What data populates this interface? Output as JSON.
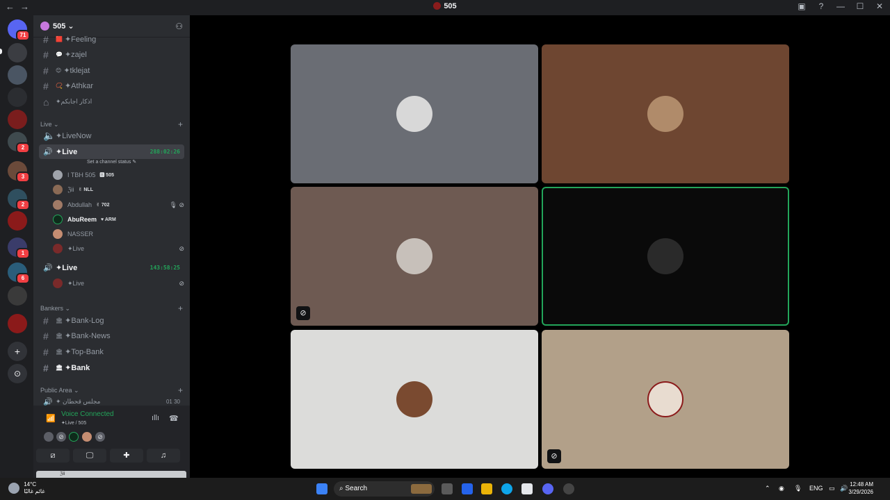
{
  "window": {
    "title": "505",
    "back": "←",
    "forward": "→",
    "controls": [
      "▣",
      "?",
      "—",
      "☐",
      "✕"
    ]
  },
  "server": {
    "name": "505 ⌄",
    "invite_icon": "add-user-icon"
  },
  "guild_badges": [
    "71",
    "2",
    "3",
    "2",
    "1",
    "6"
  ],
  "channels": {
    "top": [
      {
        "name": "✦Feeling",
        "emoji": "🟥"
      },
      {
        "name": "✦zajel",
        "emoji": "💬"
      },
      {
        "name": "✦tklejat",
        "emoji": "😊"
      },
      {
        "name": "✦Athkar",
        "emoji": "📿"
      },
      {
        "name": "✦اذكار اجابكم",
        "emoji": ""
      }
    ],
    "live_category": "Live ⌄",
    "live": [
      {
        "name": "✦LiveNow"
      },
      {
        "name": "✦Live",
        "timer": "288:02:26",
        "status": "Set a channel status ✎"
      },
      {
        "name": "✦Live",
        "timer": "143:58:25"
      }
    ],
    "voice_users": [
      {
        "name": "I TBH 505",
        "tag": "🅱 505",
        "color": "#9fa3aa"
      },
      {
        "name": "ℨii",
        "tag": "✌ NLL",
        "color": "#8a6a55"
      },
      {
        "name": "Abdullah",
        "tag": "✌ 702",
        "color": "#a07a66",
        "right": "🎙 ⊘"
      },
      {
        "name": "AbuReem",
        "tag": "♥ ARM",
        "color": "#0e2b1b"
      },
      {
        "name": "NASSER",
        "tag": "",
        "color": "#c58d72"
      },
      {
        "name": "✦Live",
        "tag": "",
        "color": "#7a2a2a",
        "right": "⊘"
      }
    ],
    "second_live_user": {
      "name": "✦Live",
      "right": "⊘"
    },
    "bankers_category": "Bankers ⌄",
    "bankers": [
      {
        "name": "✦Bank-Log"
      },
      {
        "name": "✦Bank-News"
      },
      {
        "name": "✦Top-Bank"
      },
      {
        "name": "✦Bank"
      }
    ],
    "public_category": "Public Area ⌄",
    "public": [
      {
        "name": "✦ مجلس قحطان",
        "count_left": "01",
        "count_right": "30"
      }
    ]
  },
  "voice_panel": {
    "title": "Voice Connected",
    "subtitle": "✦Live / 505",
    "buttons": [
      "camera-off-icon",
      "screen-share-icon",
      "activities-icon",
      "soundboard-icon"
    ],
    "user_strip": "ℨii"
  },
  "stage": {
    "tiles": [
      {
        "bg": "#6a6d74",
        "avatar": "#d8d8d8",
        "muted": false,
        "speaking": false
      },
      {
        "bg": "#6e4631",
        "avatar": "#b08b6a",
        "muted": false,
        "speaking": false
      },
      {
        "bg": "#6e5a52",
        "avatar": "#c7c0ba",
        "muted": true,
        "speaking": false
      },
      {
        "bg": "#0a0a0a",
        "avatar": "#2a2a2a",
        "muted": false,
        "speaking": true
      },
      {
        "bg": "#dcdcda",
        "avatar": "#7a4a30",
        "muted": false,
        "speaking": false
      },
      {
        "bg": "#b2a089",
        "avatar": "#e8dcd0",
        "muted": true,
        "speaking": false
      }
    ]
  },
  "taskbar": {
    "temp": "14°C",
    "condition": "غائم غالبًا",
    "search": "Search",
    "lang": "ENG",
    "time": "12:48 AM",
    "date": "3/29/2026"
  }
}
